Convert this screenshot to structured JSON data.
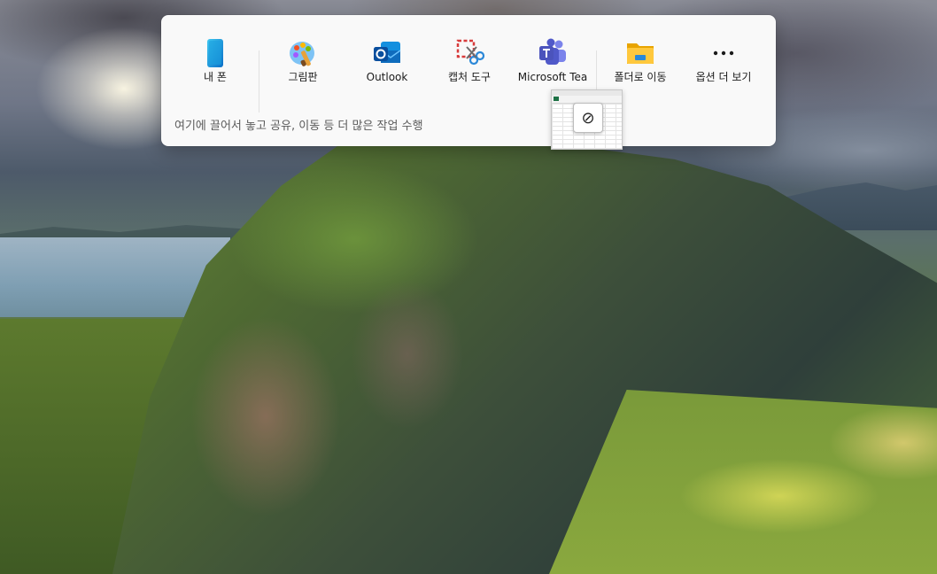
{
  "share_panel": {
    "targets": [
      {
        "label": "내 폰",
        "icon": "phone-icon"
      },
      {
        "label": "그림판",
        "icon": "paint-icon"
      },
      {
        "label": "Outlook",
        "icon": "outlook-icon"
      },
      {
        "label": "캡처 도구",
        "icon": "snipping-tool-icon"
      },
      {
        "label": "Microsoft Tea",
        "icon": "teams-icon"
      },
      {
        "label": "폴더로 이동",
        "icon": "folder-icon"
      },
      {
        "label": "옵션 더 보기",
        "icon": "more-icon"
      }
    ],
    "hint": "여기에 끌어서 놓고 공유, 이동 등 더 많은 작업 수행"
  },
  "drag_feedback": {
    "cursor_symbol": "⊘",
    "cursor_icon": "no-drop-icon"
  },
  "colors": {
    "panel_bg": "#f9f9f9",
    "excel_green": "#1e7145"
  }
}
